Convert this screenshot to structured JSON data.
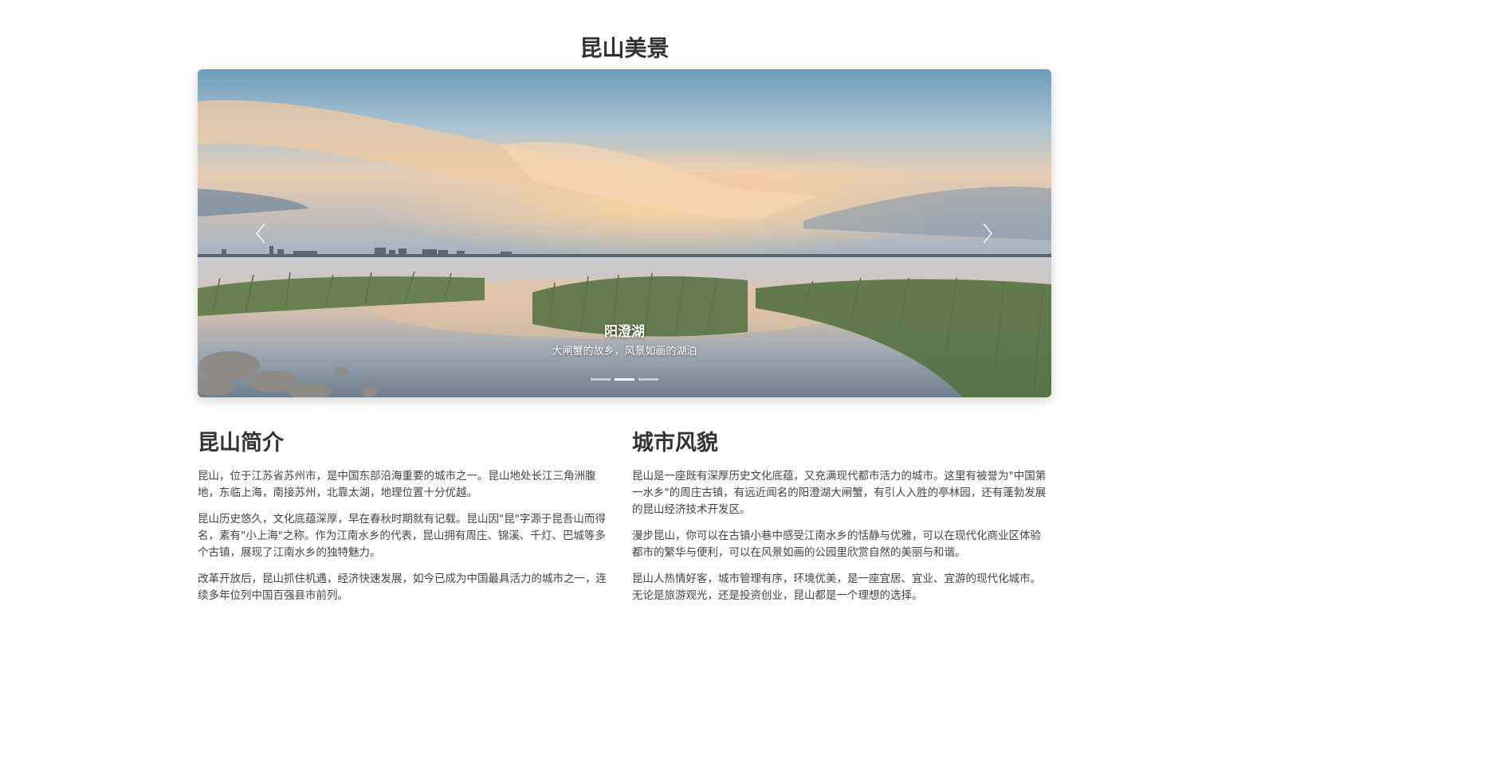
{
  "page": {
    "title": "昆山美景"
  },
  "carousel": {
    "slide_title": "阳澄湖",
    "slide_caption": "大闸蟹的故乡，风景如画的湖泊",
    "slide_count": 3,
    "active_slide": 2,
    "prev_icon": "chevron-left-icon",
    "next_icon": "chevron-right-icon"
  },
  "intro": {
    "heading": "昆山简介",
    "paragraphs": [
      "昆山，位于江苏省苏州市，是中国东部沿海重要的城市之一。昆山地处长江三角洲腹地，东临上海，南接苏州，北靠太湖，地理位置十分优越。",
      "昆山历史悠久，文化底蕴深厚，早在春秋时期就有记载。昆山因\"昆\"字源于昆吾山而得名，素有\"小上海\"之称。作为江南水乡的代表，昆山拥有周庄、锦溪、千灯、巴城等多个古镇，展现了江南水乡的独特魅力。",
      "改革开放后，昆山抓住机遇，经济快速发展，如今已成为中国最具活力的城市之一，连续多年位列中国百强县市前列。"
    ]
  },
  "city": {
    "heading": "城市风貌",
    "paragraphs": [
      "昆山是一座既有深厚历史文化底蕴，又充满现代都市活力的城市。这里有被誉为\"中国第一水乡\"的周庄古镇，有远近闻名的阳澄湖大闸蟹，有引人入胜的亭林园，还有蓬勃发展的昆山经济技术开发区。",
      "漫步昆山，你可以在古镇小巷中感受江南水乡的恬静与优雅，可以在现代化商业区体验都市的繁华与便利，可以在风景如画的公园里欣赏自然的美丽与和谐。",
      "昆山人热情好客，城市管理有序，环境优美，是一座宜居、宜业、宜游的现代化城市。无论是旅游观光，还是投资创业，昆山都是一个理想的选择。"
    ]
  }
}
